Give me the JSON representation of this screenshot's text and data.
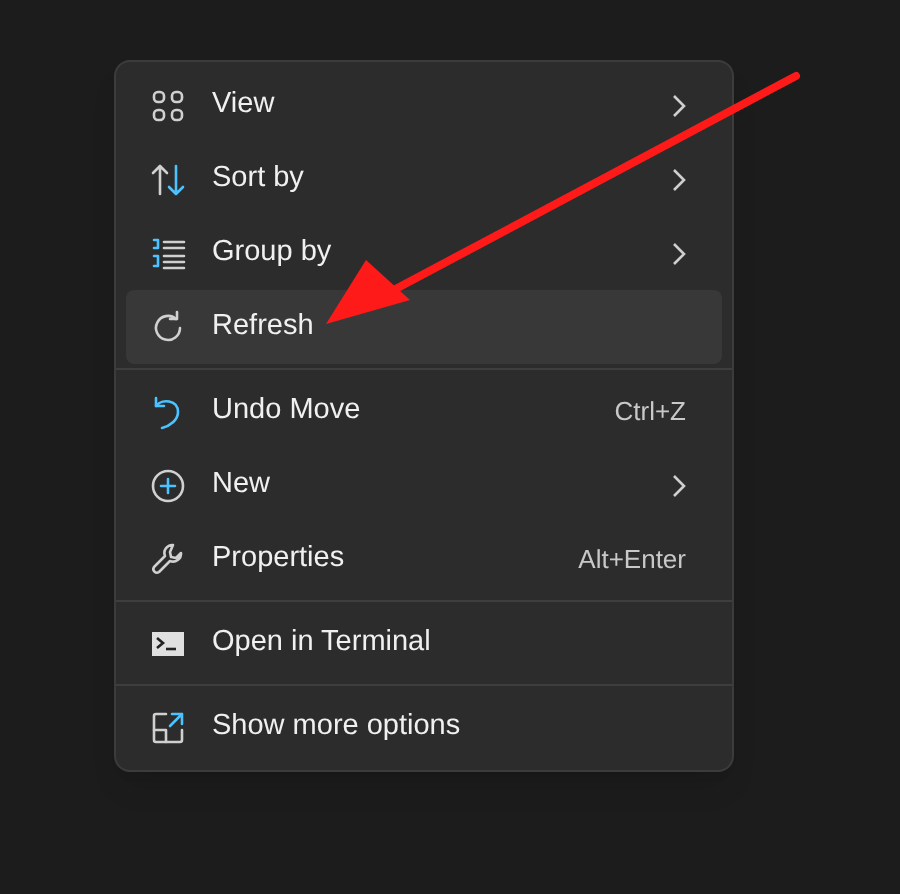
{
  "menu": {
    "groups": [
      {
        "items": [
          {
            "label": "View",
            "submenu": true,
            "selected": false
          },
          {
            "label": "Sort by",
            "submenu": true,
            "selected": false
          },
          {
            "label": "Group by",
            "submenu": true,
            "selected": false
          },
          {
            "label": "Refresh",
            "submenu": false,
            "selected": true
          }
        ]
      },
      {
        "items": [
          {
            "label": "Undo Move",
            "shortcut": "Ctrl+Z",
            "submenu": false,
            "selected": false
          },
          {
            "label": "New",
            "submenu": true,
            "selected": false
          },
          {
            "label": "Properties",
            "shortcut": "Alt+Enter",
            "submenu": false,
            "selected": false
          }
        ]
      },
      {
        "items": [
          {
            "label": "Open in Terminal",
            "submenu": false,
            "selected": false
          }
        ]
      },
      {
        "items": [
          {
            "label": "Show more options",
            "submenu": false,
            "selected": false
          }
        ]
      }
    ]
  },
  "annotation": {
    "kind": "arrow",
    "color": "#ff1a1a"
  }
}
